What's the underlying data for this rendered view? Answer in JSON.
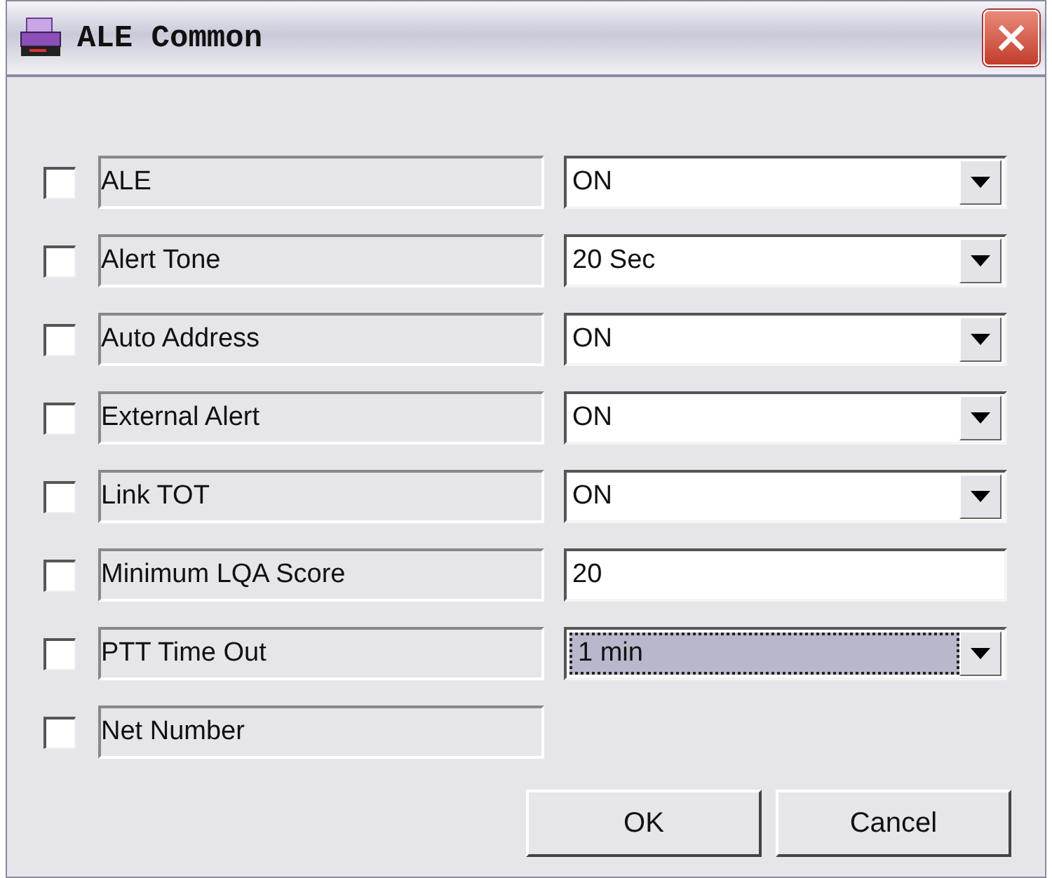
{
  "window": {
    "title": "ALE Common"
  },
  "rows": [
    {
      "label": "ALE",
      "checked": false,
      "kind": "select",
      "value": "ON",
      "focused": false
    },
    {
      "label": "Alert Tone",
      "checked": false,
      "kind": "select",
      "value": "20 Sec",
      "focused": false
    },
    {
      "label": "Auto Address",
      "checked": false,
      "kind": "select",
      "value": "ON",
      "focused": false
    },
    {
      "label": "External Alert",
      "checked": false,
      "kind": "select",
      "value": "ON",
      "focused": false
    },
    {
      "label": "Link TOT",
      "checked": false,
      "kind": "select",
      "value": "ON",
      "focused": false
    },
    {
      "label": "Minimum LQA Score",
      "checked": false,
      "kind": "text",
      "value": "20"
    },
    {
      "label": "PTT Time Out",
      "checked": false,
      "kind": "select",
      "value": "1 min",
      "focused": true
    },
    {
      "label": "Net Number",
      "checked": false,
      "kind": "none"
    }
  ],
  "buttons": [
    "OK",
    "Cancel"
  ]
}
